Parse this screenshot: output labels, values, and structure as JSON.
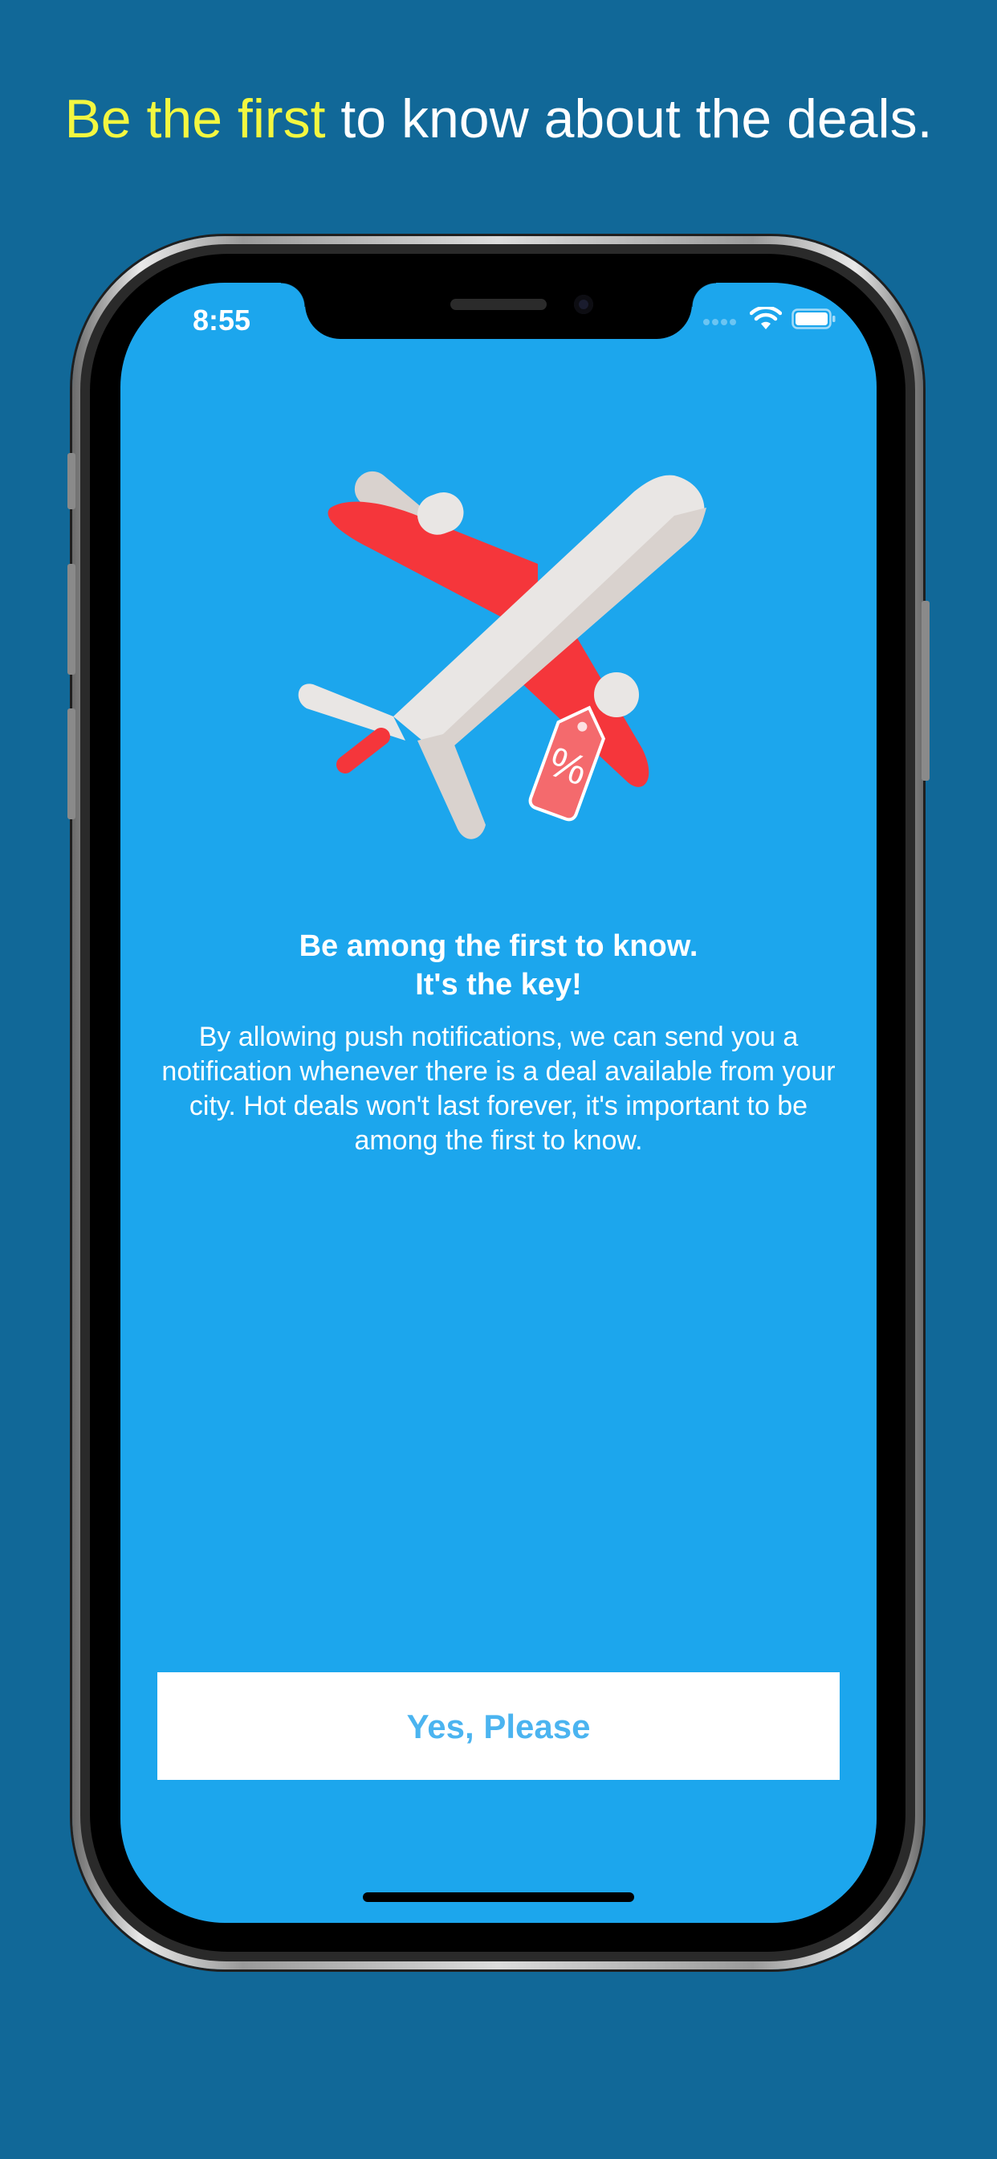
{
  "headline": {
    "highlight": "Be the first",
    "rest": " to know about the deals."
  },
  "status_bar": {
    "time": "8:55"
  },
  "onboarding": {
    "title_line1": "Be among the first to know.",
    "title_line2": "It's the key!",
    "description": "By allowing push notifications, we can send you a notification whenever there is a deal available from your city. Hot deals won't last forever, it's important to be among the first to know.",
    "tag_symbol": "%",
    "cta_label": "Yes, Please"
  },
  "colors": {
    "page_background": "#116898",
    "screen_background": "#1ca6ed",
    "headline_highlight": "#f3f740",
    "button_text": "#4bb4f0",
    "plane_wing": "#f5363b",
    "plane_body": "#e9e6e4",
    "tag": "#f46a6d"
  },
  "icons": [
    "airplane-icon",
    "discount-tag-icon",
    "wifi-icon",
    "battery-icon",
    "cellular-signal-icon"
  ]
}
